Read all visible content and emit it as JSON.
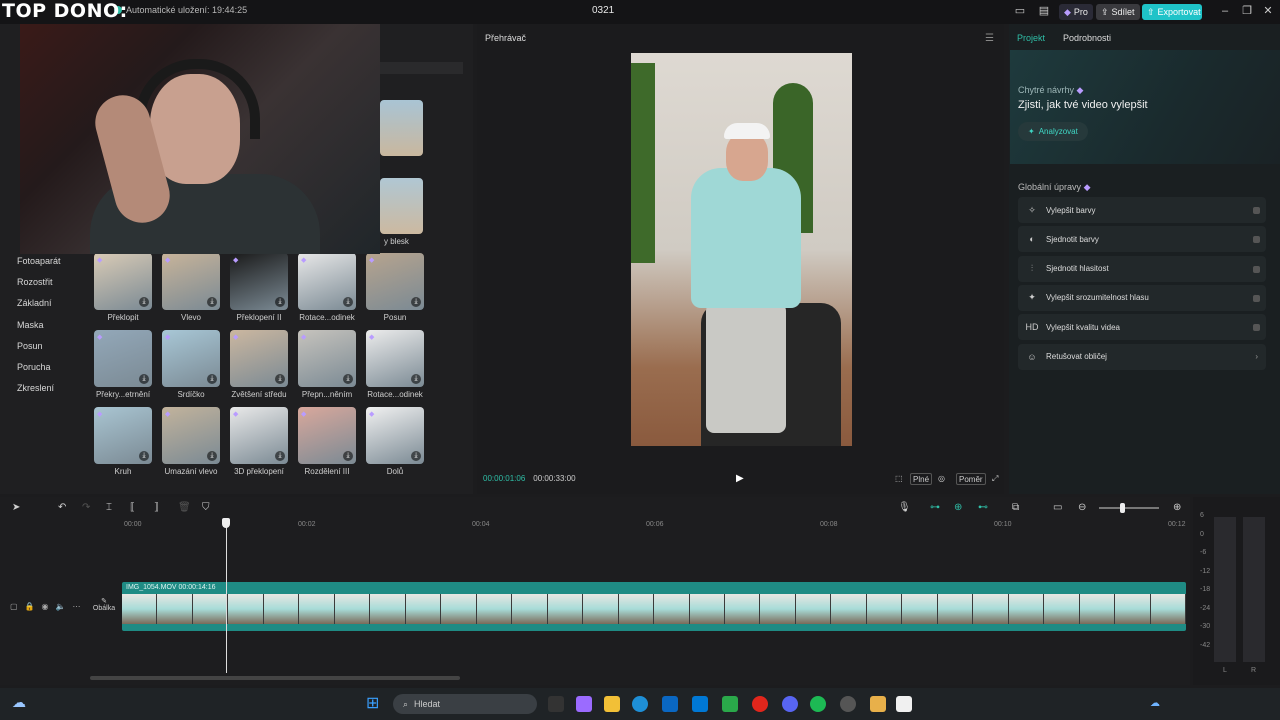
{
  "overlay_title": "TOP DONO:",
  "app": {
    "autosave": "Automatické uložení: 19:44:25",
    "project_name": "0321",
    "pro_label": "Pro",
    "share_label": "Sdílet",
    "export_label": "Exportovat"
  },
  "left": {
    "categories": [
      "Fotoaparát",
      "Rozostřit",
      "Základní",
      "Maska",
      "Posun",
      "Porucha",
      "Zkreslení"
    ],
    "top_tile_label": "y blesk",
    "tiles": [
      {
        "label": "Překlopit",
        "color": "#d9cbb6"
      },
      {
        "label": "Vlevo",
        "color": "#c8b49a"
      },
      {
        "label": "Překlopení II",
        "color": "#1a1a1a"
      },
      {
        "label": "Rotace...odinek",
        "color": "#e8e8e8"
      },
      {
        "label": "Posun",
        "color": "#b7a48e"
      },
      {
        "label": "Překry...etrnění",
        "color": "#93a8b9"
      },
      {
        "label": "Srdíčko",
        "color": "#a8c7d6"
      },
      {
        "label": "Zvětšení středu",
        "color": "#cbb7a0"
      },
      {
        "label": "Přepn...něním",
        "color": "#c6c3bd"
      },
      {
        "label": "Rotace...odinek",
        "color": "#ececec"
      },
      {
        "label": "Kruh",
        "color": "#a9c5d2"
      },
      {
        "label": "Umazání vlevo",
        "color": "#c2b39c"
      },
      {
        "label": "3D překlopení",
        "color": "#e9e9e9"
      },
      {
        "label": "Rozdělení III",
        "color": "#d9a89c"
      },
      {
        "label": "Dolů",
        "color": "#f1f1f1"
      }
    ]
  },
  "player": {
    "title": "Přehrávač",
    "current_time": "00:00:01:06",
    "total_time": "00:00:33:00",
    "ctl_full": "Plné",
    "ctl_ratio": "Poměr"
  },
  "right": {
    "tab_project": "Projekt",
    "tab_details": "Podrobnosti",
    "smart_heading": "Chytré návrhy",
    "smart_title": "Zjisti, jak tvé video vylepšit",
    "analyze": "Analyzovat",
    "global_heading": "Globální úpravy",
    "options": [
      {
        "icon": "✧",
        "label": "Vylepšit barvy"
      },
      {
        "icon": "◐",
        "label": "Sjednotit barvy"
      },
      {
        "icon": "⫶",
        "label": "Sjednotit hlasitost"
      },
      {
        "icon": "✦",
        "label": "Vylepšit srozumitelnost hlasu"
      },
      {
        "icon": "HD",
        "label": "Vylepšit kvalitu videa"
      },
      {
        "icon": "☺",
        "label": "Retušovat obličej"
      }
    ]
  },
  "timeline": {
    "ruler": [
      "00:00",
      "00:02",
      "00:04",
      "00:06",
      "00:08",
      "00:10",
      "00:12"
    ],
    "clip_label": "IMG_1054.MOV   00:00:14:16",
    "cover": "Obálka",
    "meter_labels": [
      "6",
      "0",
      "-6",
      "-12",
      "-18",
      "-24",
      "-30",
      "-42"
    ],
    "meter_lr": [
      "L",
      "R"
    ]
  },
  "taskbar": {
    "search": "Hledat"
  }
}
